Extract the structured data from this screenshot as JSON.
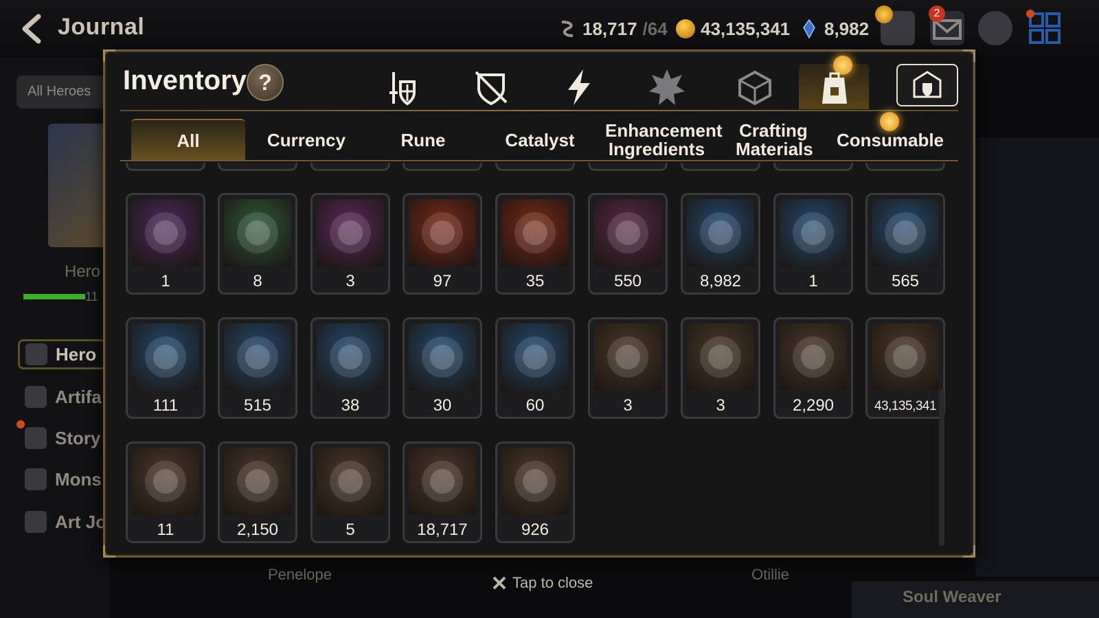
{
  "header": {
    "title": "Journal",
    "stamina": {
      "value": "18,717",
      "max": "/64"
    },
    "gold": "43,135,341",
    "crystals": "8,982",
    "mail_badge": "2"
  },
  "sidebar": {
    "filter_label": "All Heroes",
    "hero_label": "Hero",
    "hp_number": "11",
    "items": [
      {
        "label": "Hero",
        "icon": "hero-icon"
      },
      {
        "label": "Artifa",
        "icon": "lightning-icon"
      },
      {
        "label": "Story",
        "icon": "scroll-icon"
      },
      {
        "label": "Mons",
        "icon": "dragon-icon"
      },
      {
        "label": "Art Jo",
        "icon": "brush-icon"
      }
    ]
  },
  "bottom": {
    "left_name": "Penelope",
    "right_name": "Otillie",
    "tap_close": "Tap to close",
    "soul_weaver": "Soul Weaver"
  },
  "inventory": {
    "title": "Inventory",
    "help": "?",
    "categories": [
      "equipment-icon",
      "sealed-equipment-icon",
      "lightning-icon",
      "spiked-gear-icon",
      "cube-icon",
      "backpack-icon",
      "storage-icon"
    ],
    "subtabs": [
      {
        "label": "All",
        "active": true
      },
      {
        "label": "Currency"
      },
      {
        "label": "Rune"
      },
      {
        "label": "Catalyst"
      },
      {
        "label": "Enhancement Ingredients"
      },
      {
        "label": "Crafting Materials"
      },
      {
        "label": "Consumable"
      }
    ],
    "rows": [
      [
        {
          "qty": "1",
          "icon": "pet-pack-purple-icon",
          "bg": "#4a2a5e"
        },
        {
          "qty": "8",
          "icon": "pet-pack-green-icon",
          "bg": "#2e5a3a"
        },
        {
          "qty": "3",
          "icon": "feather-staff-icon",
          "bg": "#5a2a5a"
        },
        {
          "qty": "97",
          "icon": "gold-crystal-icon",
          "bg": "#7a2a1a"
        },
        {
          "qty": "35",
          "icon": "blue-pendant-icon",
          "bg": "#7a2a1a"
        },
        {
          "qty": "550",
          "icon": "red-rune-icon",
          "bg": "#5a2a4a"
        },
        {
          "qty": "8,982",
          "icon": "blue-gem-icon",
          "bg": "#244a6e"
        },
        {
          "qty": "1",
          "icon": "compass-sword-icon",
          "bg": "#244a6e"
        },
        {
          "qty": "565",
          "icon": "silver-coin-icon",
          "bg": "#244a6e"
        }
      ],
      [
        {
          "qty": "111",
          "icon": "cyan-crystal-icon",
          "bg": "#244a6e"
        },
        {
          "qty": "515",
          "icon": "green-leaf-icon",
          "bg": "#244a6e"
        },
        {
          "qty": "38",
          "icon": "purple-card-icon",
          "bg": "#244a6e"
        },
        {
          "qty": "30",
          "icon": "star-amulet-icon",
          "bg": "#244a6e"
        },
        {
          "qty": "60",
          "icon": "green-card-icon",
          "bg": "#244a6e"
        },
        {
          "qty": "3",
          "icon": "pink-orb-icon",
          "bg": "#4a3a2a"
        },
        {
          "qty": "3",
          "icon": "red-seal-icon",
          "bg": "#4a3a2a"
        },
        {
          "qty": "2,290",
          "icon": "green-heart-icon",
          "bg": "#4a3a2a"
        },
        {
          "qty": "43,135,341",
          "icon": "gold-coin-icon",
          "bg": "#4a3a2a"
        }
      ],
      [
        {
          "qty": "11",
          "icon": "stone-block-icon",
          "bg": "#4a3a2a"
        },
        {
          "qty": "2,150",
          "icon": "fist-emblem-icon",
          "bg": "#4a3a2a"
        },
        {
          "qty": "5",
          "icon": "banner-icon",
          "bg": "#4a3a2a"
        },
        {
          "qty": "18,717",
          "icon": "horse-head-icon",
          "bg": "#4a3a2a"
        },
        {
          "qty": "926",
          "icon": "red-leaves-icon",
          "bg": "#4a3a2a"
        }
      ]
    ]
  }
}
